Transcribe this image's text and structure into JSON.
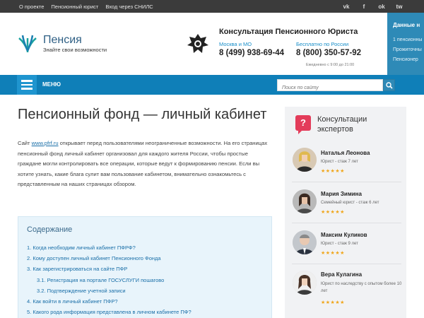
{
  "topbar": {
    "links": [
      "О проекте",
      "Пенсионный юрист",
      "Вход через СНИЛС"
    ],
    "social": [
      {
        "icon": "vk-icon",
        "glyph": "vk"
      },
      {
        "icon": "facebook-icon",
        "glyph": "f"
      },
      {
        "icon": "odnoklassniki-icon",
        "glyph": "ok"
      },
      {
        "icon": "twitter-icon",
        "glyph": "tw"
      }
    ]
  },
  "header": {
    "logo_name": "Пенсия",
    "logo_tagline": "Знайте свои возможности",
    "consult_title": "Консультация Пенсионного Юриста",
    "phone1_label": "Москва и МО",
    "phone1_number": "8 (499) 938-69-44",
    "phone2_label": "Бесплатно по России",
    "phone2_number": "8 (800) 350-57-92",
    "hours": "Ежедневно с 9:00 до 21:00",
    "right_panel_title": "Данные н",
    "right_panel_items": [
      "1 пенсионны",
      "Прожиточны",
      "Пенсионер"
    ]
  },
  "nav": {
    "menu_label": "МЕНЮ",
    "search_placeholder": "Поиск по сайту"
  },
  "main": {
    "title": "Пенсионный фонд — личный кабинет",
    "intro_before_link": "Сайт ",
    "intro_link": "www.pfrf.ru",
    "intro_after_link": " открывает перед пользователями неограниченные возможности. На его страницах пенсионный фонд личный кабинет организовал для каждого жителя России, чтобы простые граждане могли контролировать все операции, которые ведут к формированию пенсии. Если вы хотите узнать, какие блага сулит вам пользование кабинетом, внимательно ознакомьтесь с представленным на наших страницах обзором.",
    "toc_title": "Содержание",
    "toc": [
      {
        "label": "1.  Когда необходим личный кабинет ПФРФ?",
        "sub": false
      },
      {
        "label": "2.  Кому доступен личный кабинет Пенсионного Фонда",
        "sub": false
      },
      {
        "label": "3.  Как зарегистрироваться на сайте ПФР",
        "sub": false
      },
      {
        "label": "3.1.  Регистрация на портале ГОСУСЛУГИ пошагово",
        "sub": true
      },
      {
        "label": "3.2.  Подтверждение учетной записи",
        "sub": true
      },
      {
        "label": "4.  Как войти в личный кабинет ПФР?",
        "sub": false
      },
      {
        "label": "5.  Какого рода информация представлена в личном кабинете ПФ?",
        "sub": false
      }
    ]
  },
  "sidebar": {
    "title_line1": "Консультации",
    "title_line2": "экспертов",
    "icon": "question-icon",
    "experts": [
      {
        "name": "Наталья Леонова",
        "role": "Юрист - стаж 7 лет",
        "stars": "★★★★★"
      },
      {
        "name": "Мария Зимина",
        "role": "Семейный юрист - стаж 6 лет",
        "stars": "★★★★★"
      },
      {
        "name": "Максим Куликов",
        "role": "Юрист - стаж 9 лет",
        "stars": "★★★★★"
      },
      {
        "name": "Вера Кулагина",
        "role": "Юрист по наследству с опытом более 10 лет",
        "stars": "★★★★★"
      }
    ]
  },
  "colors": {
    "topbar": "#3b3b3b",
    "nav": "#0f7fb8",
    "accent_blue": "#1a8fc9",
    "question_icon": "#e33c5a",
    "stars": "#f0a61b"
  }
}
